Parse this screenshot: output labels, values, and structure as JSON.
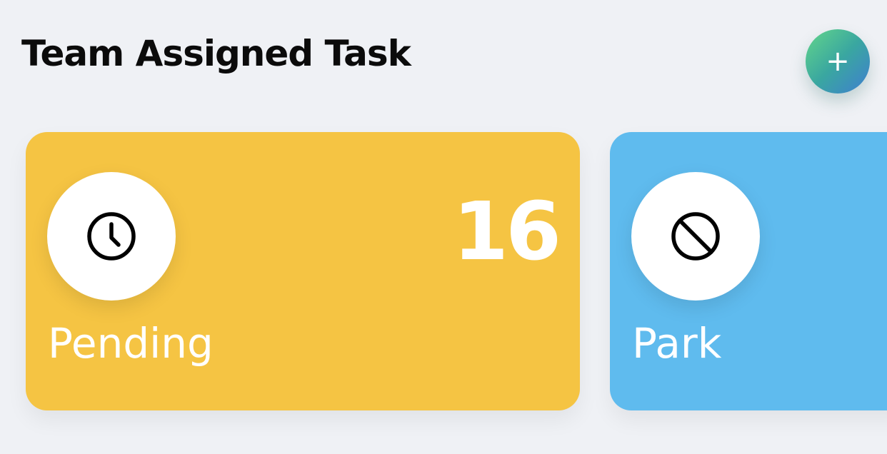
{
  "header": {
    "title": "Team Assigned Task",
    "add_label": "+",
    "add_icon": "plus-icon"
  },
  "cards": [
    {
      "label": "Pending",
      "count": "16",
      "icon": "clock-icon",
      "color": "#f5c443"
    },
    {
      "label": "Park",
      "count": "",
      "icon": "block-icon",
      "color": "#5fbbee"
    }
  ],
  "colors": {
    "background": "#eff1f5",
    "icon_bg": "#ffffff",
    "title_text": "#0b0b0b",
    "add_gradient_start": "#63d68a",
    "add_gradient_end": "#3f7ed1"
  }
}
